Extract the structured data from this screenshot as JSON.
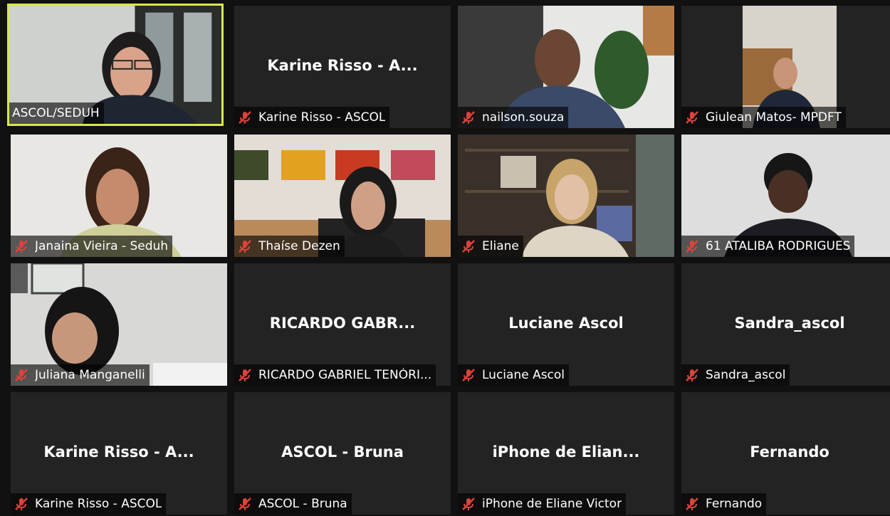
{
  "tiles": [
    {
      "center": "",
      "label": "ASCOL/SEDUH",
      "video": true
    },
    {
      "center": "Karine Risso - A...",
      "label": "Karine Risso - ASCOL",
      "video": false
    },
    {
      "center": "",
      "label": "nailson.souza",
      "video": true
    },
    {
      "center": "",
      "label": "Giulean Matos- MPDFT",
      "video": true
    },
    {
      "center": "",
      "label": "Janaina Vieira - Seduh",
      "video": true
    },
    {
      "center": "",
      "label": "Thaíse Dezen",
      "video": true
    },
    {
      "center": "",
      "label": "Eliane",
      "video": true
    },
    {
      "center": "",
      "label": "61 ATALIBA RODRIGUES",
      "video": true
    },
    {
      "center": "",
      "label": "Juliana Manganelli",
      "video": true
    },
    {
      "center": "RICARDO GABR...",
      "label": "RICARDO GABRIEL TENÓRI...",
      "video": false
    },
    {
      "center": "Luciane Ascol",
      "label": "Luciane Ascol",
      "video": false
    },
    {
      "center": "Sandra_ascol",
      "label": "Sandra_ascol",
      "video": false
    },
    {
      "center": "Karine Risso - A...",
      "label": "Karine Risso - ASCOL",
      "video": false
    },
    {
      "center": "ASCOL - Bruna",
      "label": "ASCOL - Bruna",
      "video": false
    },
    {
      "center": "iPhone de Elian...",
      "label": "iPhone de Eliane Victor",
      "video": false
    },
    {
      "center": "Fernando",
      "label": "Fernando",
      "video": false
    }
  ],
  "colors": {
    "active_speaker_border": "#d7e84a",
    "muted_mic": "#d9443b",
    "tile_background": "#232323"
  },
  "icons": {
    "muted": "muted-mic-icon"
  }
}
